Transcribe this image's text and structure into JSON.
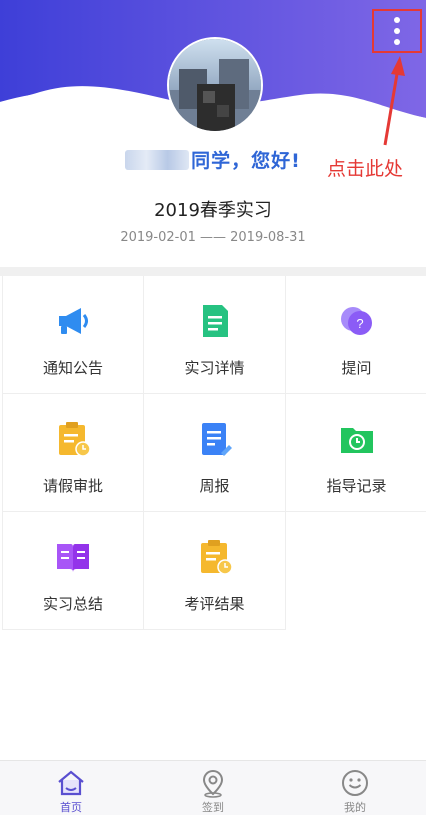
{
  "header": {
    "greeting_suffix": "同学，您好!",
    "program_title": "2019春季实习",
    "date_range": "2019-02-01 —— 2019-08-31",
    "menu_icon": "more-vertical-icon",
    "colors": {
      "header_start": "#4a42e0",
      "header_end": "#8c6fe8",
      "greeting": "#2f66d6"
    }
  },
  "annotation": {
    "text": "点击此处",
    "color": "#e53935"
  },
  "features": [
    {
      "label": "通知公告",
      "icon": "megaphone-icon"
    },
    {
      "label": "实习详情",
      "icon": "document-icon"
    },
    {
      "label": "提问",
      "icon": "question-bubble-icon"
    },
    {
      "label": "请假审批",
      "icon": "leave-approval-icon"
    },
    {
      "label": "周报",
      "icon": "weekly-report-icon"
    },
    {
      "label": "指导记录",
      "icon": "folder-clock-icon"
    },
    {
      "label": "实习总结",
      "icon": "book-icon"
    },
    {
      "label": "考评结果",
      "icon": "evaluation-icon"
    }
  ],
  "tabbar": {
    "items": [
      {
        "label": "首页",
        "icon": "home-icon",
        "active": true
      },
      {
        "label": "签到",
        "icon": "location-pin-icon",
        "active": false
      },
      {
        "label": "我的",
        "icon": "smiley-icon",
        "active": false
      }
    ]
  }
}
